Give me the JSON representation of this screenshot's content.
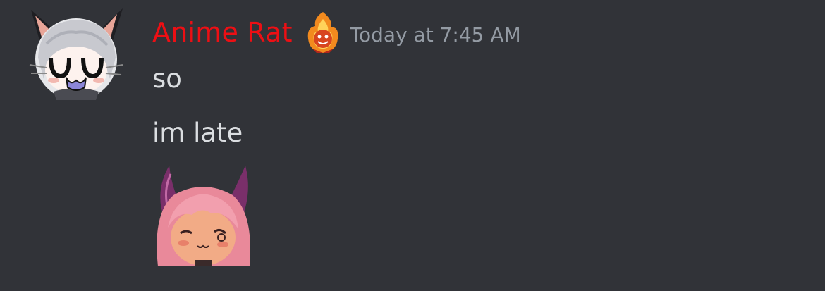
{
  "author": {
    "name": "Anime Rat",
    "name_color": "#ed0f14",
    "avatar_icon": "cat-ear-girl-avatar-icon",
    "role_icon": "flame-badge-icon"
  },
  "timestamp": "Today at 7:45 AM",
  "messages": [
    {
      "text": "so"
    },
    {
      "text": "im late"
    }
  ],
  "sticker": {
    "icon": "horned-girl-sticker-icon"
  },
  "colors": {
    "background": "#313338",
    "message_text": "#dbdee1",
    "timestamp": "#949ba4"
  }
}
